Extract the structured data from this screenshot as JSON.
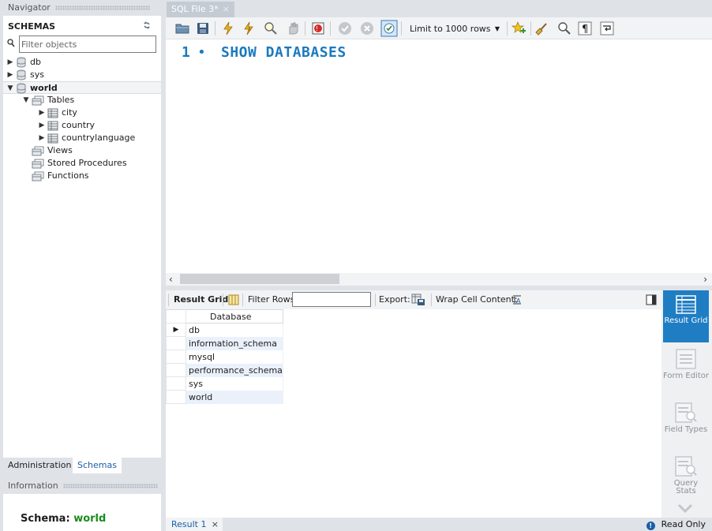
{
  "navigator": {
    "header": "Navigator",
    "schemas_title": "SCHEMAS",
    "filter_placeholder": "Filter objects",
    "tree": [
      {
        "label": "db",
        "expanded": false
      },
      {
        "label": "sys",
        "expanded": false
      },
      {
        "label": "world",
        "expanded": true,
        "bold": true
      }
    ],
    "world_children": {
      "tables_label": "Tables",
      "tables": [
        "city",
        "country",
        "countrylanguage"
      ],
      "views_label": "Views",
      "procedures_label": "Stored Procedures",
      "functions_label": "Functions"
    },
    "tabs": {
      "administration": "Administration",
      "schemas": "Schemas"
    },
    "info_header": "Information",
    "info": {
      "label": "Schema:",
      "value": "world"
    }
  },
  "editor": {
    "tab_label": "SQL File 3*",
    "tab_close": "×",
    "limit_label": "Limit to 1000 rows",
    "line_number": "1",
    "line_marker": "•",
    "sql": "SHOW DATABASES"
  },
  "results": {
    "result_grid_label": "Result Grid",
    "filter_rows_label": "Filter Rows:",
    "export_label": "Export:",
    "wrap_label": "Wrap Cell Content:",
    "column_header": "Database",
    "rows": [
      "db",
      "information_schema",
      "mysql",
      "performance_schema",
      "sys",
      "world"
    ],
    "bottom_tab": "Result 1",
    "bottom_tab_close": "×",
    "status": "Read Only"
  },
  "side_panel": {
    "result_grid": "Result Grid",
    "form_editor": "Form Editor",
    "field_types": "Field Types",
    "query_stats": "Query Stats"
  },
  "colors": {
    "accent": "#1f7dc4",
    "sql_keyword": "#1a7abf",
    "schema_value": "#1b8a1b",
    "row_alt": "#eaf1fb"
  }
}
